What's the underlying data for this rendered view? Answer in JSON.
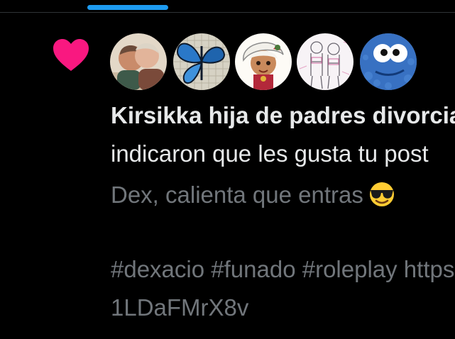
{
  "tabs": {
    "active_indicator_color": "#1d9bf0"
  },
  "notification": {
    "type_icon": "heart-icon",
    "heart_color": "#f91880",
    "avatars": [
      {
        "icon": "avatar-kissing-couple"
      },
      {
        "icon": "avatar-blue-butterfly"
      },
      {
        "icon": "avatar-anime-character"
      },
      {
        "icon": "avatar-sketch-drawing"
      },
      {
        "icon": "avatar-cookie-monster"
      }
    ],
    "title_line": "Kirsikka hija de padres divorciados",
    "action_line": "indicaron que les gusta tu post",
    "post_line": "Dex, calienta que entras",
    "post_emoji": "smiling-face-with-sunglasses-icon",
    "hashtags_line": "#dexacio #funado #roleplay https://t.co/",
    "link_line": "1LDaFMrX8v"
  }
}
